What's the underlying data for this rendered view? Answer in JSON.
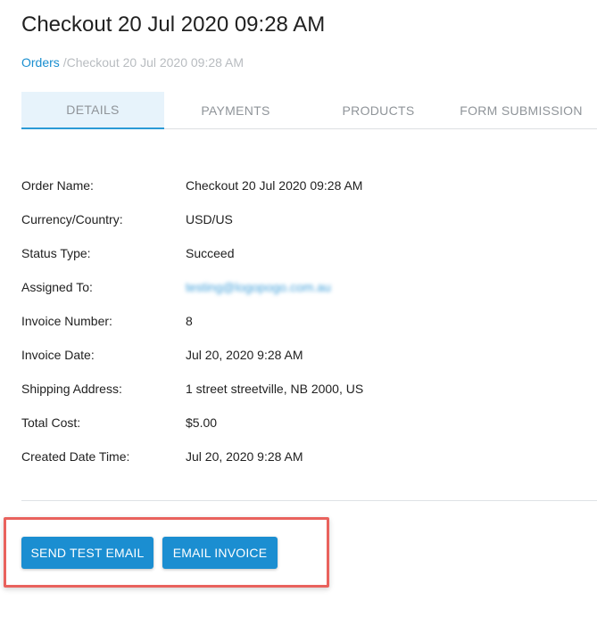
{
  "header": {
    "title": "Checkout 20 Jul 2020 09:28 AM"
  },
  "breadcrumb": {
    "link_label": "Orders",
    "current_label": "/Checkout 20 Jul 2020 09:28 AM"
  },
  "tabs": [
    {
      "label": "DETAILS",
      "active": true
    },
    {
      "label": "PAYMENTS",
      "active": false
    },
    {
      "label": "PRODUCTS",
      "active": false
    },
    {
      "label": "FORM SUBMISSION",
      "active": false
    }
  ],
  "details": [
    {
      "label": "Order Name:",
      "value": "Checkout 20 Jul 2020 09:28 AM"
    },
    {
      "label": "Currency/Country:",
      "value": "USD/US"
    },
    {
      "label": "Status Type:",
      "value": "Succeed"
    },
    {
      "label": "Assigned To:",
      "value": "testing@logopogo.com.au"
    },
    {
      "label": "Invoice Number:",
      "value": "8"
    },
    {
      "label": "Invoice Date:",
      "value": "Jul 20, 2020 9:28 AM"
    },
    {
      "label": "Shipping Address:",
      "value": "1 street streetville, NB 2000, US"
    },
    {
      "label": "Total Cost:",
      "value": "$5.00"
    },
    {
      "label": "Created Date Time:",
      "value": "Jul 20, 2020 9:28 AM"
    }
  ],
  "actions": {
    "send_test_email_label": "SEND TEST EMAIL",
    "email_invoice_label": "EMAIL INVOICE"
  },
  "colors": {
    "accent": "#1b8ed1",
    "link": "#1a8fd0",
    "active_tab_bg": "#e7f3fb",
    "highlight": "#e9625d"
  }
}
